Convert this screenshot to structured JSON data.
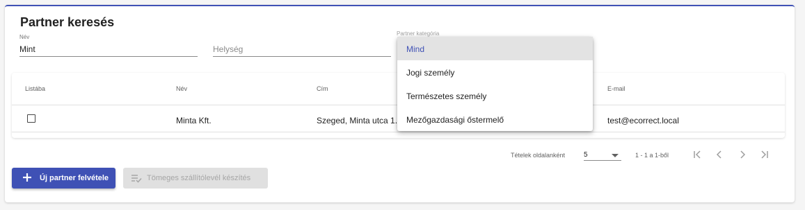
{
  "page": {
    "title": "Partner keresés"
  },
  "search": {
    "name_label": "Név",
    "name_value": "Mint",
    "city_placeholder": "Helység",
    "type_label": "Partner kategória"
  },
  "table": {
    "headers": [
      "Listába",
      "Név",
      "Cím",
      "E-mail"
    ],
    "rows": [
      {
        "name": "Minta Kft.",
        "address": "Szeged, Minta utca 1.",
        "email": "test@ecorrect.local"
      }
    ]
  },
  "pagination": {
    "per_page_label": "Tételek oldalanként",
    "per_page_value": "5",
    "range": "1 - 1 a 1-ből"
  },
  "buttons": {
    "new_partner": "Új partner felvétele",
    "bulk_waybill": "Tömeges szállítólevél készítés"
  },
  "dropdown": {
    "options": [
      "Mind",
      "Jogi személy",
      "Természetes személy",
      "Mezőgazdasági őstermelő"
    ],
    "selected_index": 0
  },
  "colors": {
    "primary": "#3f51b5",
    "disabled_bg": "#e0e0e0"
  },
  "icons": [
    "plus-icon",
    "playlist-check-icon",
    "first-page-icon",
    "previous-page-icon",
    "next-page-icon",
    "last-page-icon",
    "dropdown-arrow-icon",
    "checkbox-icon"
  ]
}
